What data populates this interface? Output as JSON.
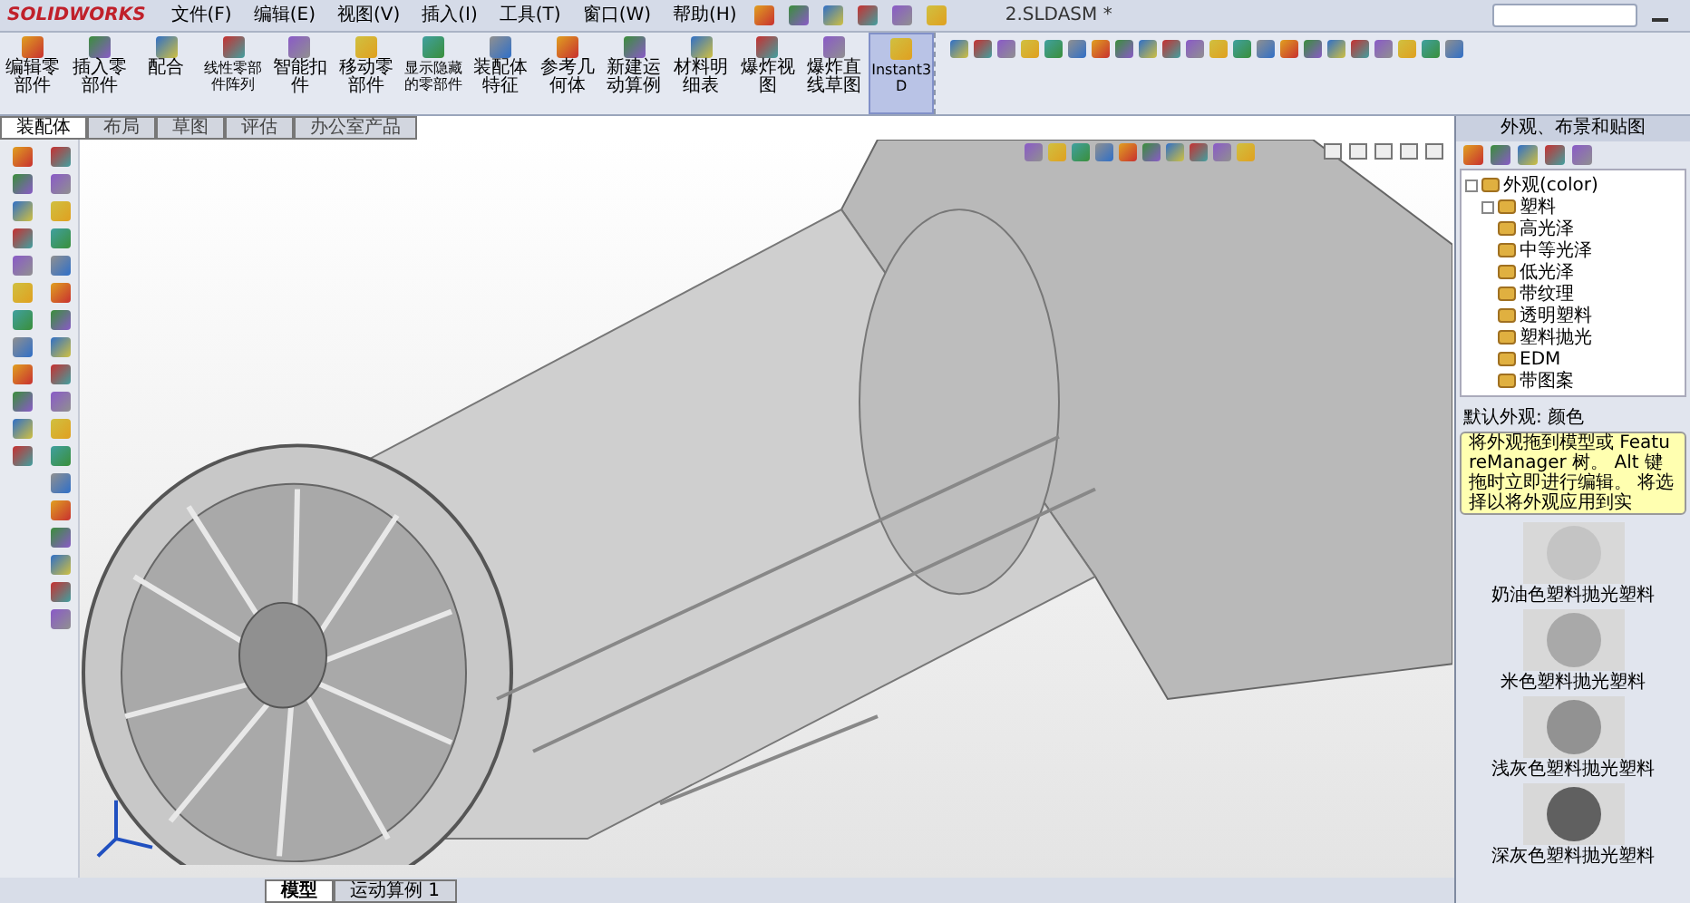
{
  "window": {
    "title": "2.SLDASM *",
    "app_name": "SOLIDWORKS"
  },
  "menu": [
    "文件(F)",
    "编辑(E)",
    "视图(V)",
    "插入(I)",
    "工具(T)",
    "窗口(W)",
    "帮助(H)"
  ],
  "ribbon": [
    {
      "label": "编辑零部件",
      "selected": false
    },
    {
      "label": "插入零部件",
      "selected": false
    },
    {
      "label": "配合",
      "selected": false
    },
    {
      "label": "线性零部件阵列",
      "selected": false
    },
    {
      "label": "智能扣件",
      "selected": false
    },
    {
      "label": "移动零部件",
      "selected": false
    },
    {
      "label": "显示隐藏的零部件",
      "selected": false
    },
    {
      "label": "装配体特征",
      "selected": false
    },
    {
      "label": "参考几何体",
      "selected": false
    },
    {
      "label": "新建运动算例",
      "selected": false
    },
    {
      "label": "材料明细表",
      "selected": false
    },
    {
      "label": "爆炸视图",
      "selected": false
    },
    {
      "label": "爆炸直线草图",
      "selected": false
    },
    {
      "label": "Instant3D",
      "selected": true
    }
  ],
  "command_tabs": [
    {
      "label": "装配体",
      "selected": true
    },
    {
      "label": "布局",
      "selected": false
    },
    {
      "label": "草图",
      "selected": false
    },
    {
      "label": "评估",
      "selected": false
    },
    {
      "label": "办公室产品",
      "selected": false
    }
  ],
  "task_pane": {
    "title": "外观、布景和贴图",
    "tree": [
      {
        "label": "外观(color)",
        "expanded": true,
        "children": [
          {
            "label": "塑料",
            "expanded": true,
            "children": [
              {
                "label": "高光泽"
              },
              {
                "label": "中等光泽"
              },
              {
                "label": "低光泽"
              },
              {
                "label": "带纹理"
              },
              {
                "label": "透明塑料"
              },
              {
                "label": "塑料抛光"
              },
              {
                "label": "EDM"
              },
              {
                "label": "带图案"
              }
            ]
          }
        ]
      }
    ],
    "section_title": "默认外观: 颜色",
    "tooltip": "将外观拖到模型或 FeatureManager 树。 Alt 键拖时立即进行编辑。 将选择以将外观应用到实",
    "swatches": [
      {
        "label": "奶油色塑料抛光塑料",
        "color": "#c4c4c4"
      },
      {
        "label": "米色塑料抛光塑料",
        "color": "#a9a9a9"
      },
      {
        "label": "浅灰色塑料抛光塑料",
        "color": "#929292"
      },
      {
        "label": "深灰色塑料抛光塑料",
        "color": "#606060"
      }
    ]
  },
  "bottom_tabs": [
    {
      "label": "模型",
      "selected": true
    },
    {
      "label": "运动算例 1",
      "selected": false
    }
  ]
}
